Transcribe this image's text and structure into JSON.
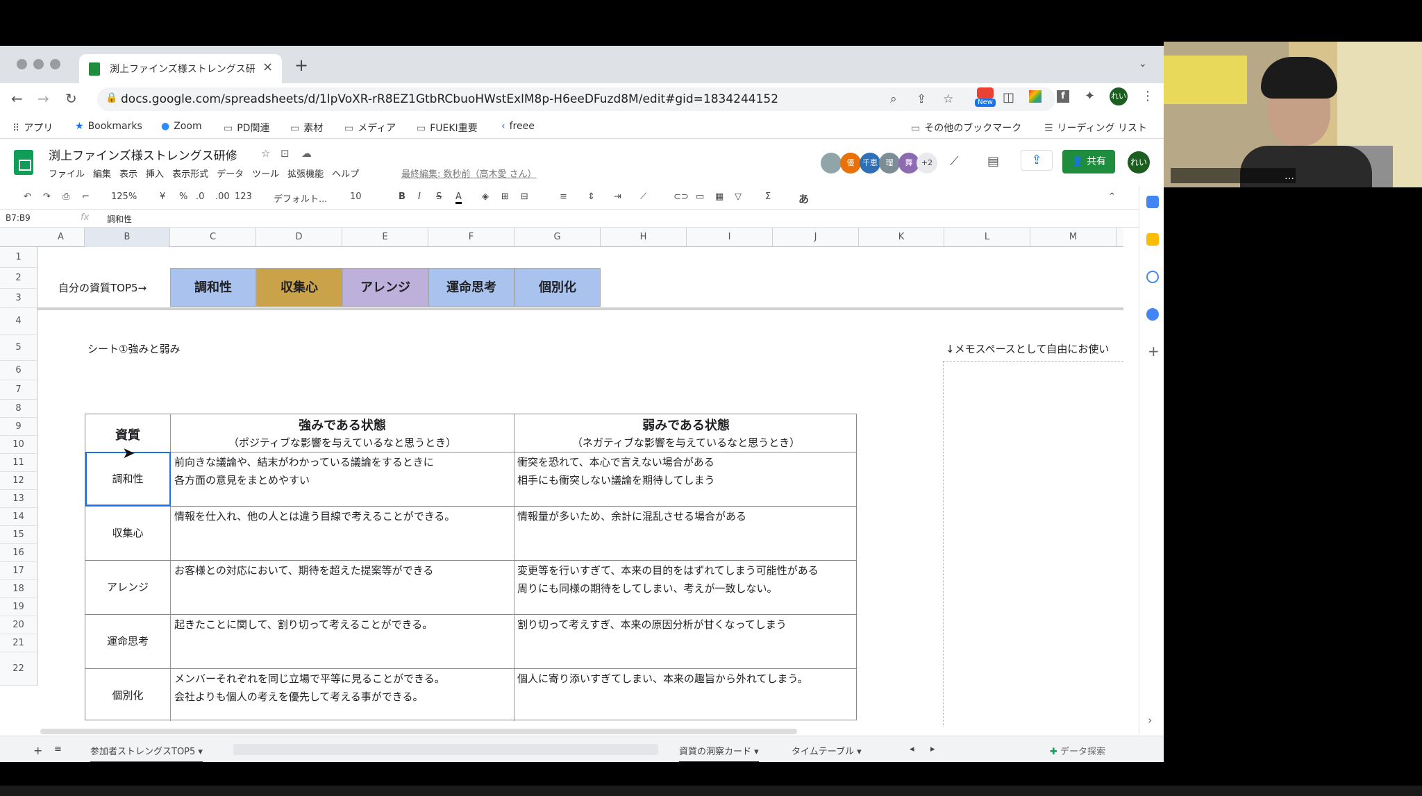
{
  "browser": {
    "tab_title": "渕上ファインズ様ストレングス研修",
    "url": "docs.google.com/spreadsheets/d/1lpVoXR-rR8EZ1GtbRCbuoHWstExlM8p-H6eeDFuzd8M/edit#gid=1834244152",
    "new_badge": "New",
    "profile": "れい"
  },
  "bookmarks": {
    "apps": "アプリ",
    "items": [
      "Bookmarks",
      "Zoom",
      "PD関連",
      "素材",
      "メディア",
      "FUEKI重要",
      "freee"
    ],
    "other": "その他のブックマーク",
    "reading_list": "リーディング リスト"
  },
  "app": {
    "doc_title": "渕上ファインズ様ストレングス研修",
    "menus": [
      "ファイル",
      "編集",
      "表示",
      "挿入",
      "表示形式",
      "データ",
      "ツール",
      "拡張機能",
      "ヘルプ"
    ],
    "last_edit": "最終編集: 数秒前（高木愛 さん）",
    "avatars": [
      "優",
      "千恵",
      "瑠",
      "舞"
    ],
    "avatar_more": "+2",
    "share": "共有",
    "me": "れい"
  },
  "format_toolbar": {
    "zoom": "125%",
    "currency": "¥",
    "percent": "%",
    "dec_less": ".0",
    "dec_more": ".00",
    "number_format": "123",
    "font": "デフォルト...",
    "font_size": "10",
    "input_method": "あ"
  },
  "formula_bar": {
    "name_box": "B7:B9",
    "fx": "fx",
    "content": "調和性"
  },
  "columns": [
    "A",
    "B",
    "C",
    "D",
    "E",
    "F",
    "G",
    "H",
    "I",
    "J",
    "K",
    "L",
    "M"
  ],
  "rows": [
    "1",
    "2",
    "3",
    "4",
    "5",
    "6",
    "7",
    "8",
    "9",
    "10",
    "11",
    "12",
    "13",
    "14",
    "15",
    "16",
    "17",
    "18",
    "19",
    "20",
    "21",
    "22"
  ],
  "sheet": {
    "top5_label": "自分の資質TOP5→",
    "top5": [
      "調和性",
      "収集心",
      "アレンジ",
      "運命思考",
      "個別化"
    ],
    "caption": "シート①強みと弱み",
    "memo_caption": "↓メモスペースとして自由にお使い",
    "table": {
      "col_talent": "資質",
      "col_strength": "強みである状態",
      "col_strength_sub": "（ポジティブな影響を与えているなと思うとき）",
      "col_weakness": "弱みである状態",
      "col_weakness_sub": "（ネガティブな影響を与えているなと思うとき）",
      "rows": [
        {
          "talent": "調和性",
          "strength1": "前向きな議論や、結末がわかっている議論をするときに",
          "strength2": "各方面の意見をまとめやすい",
          "weakness1": "衝突を恐れて、本心で言えない場合がある",
          "weakness2": "相手にも衝突しない議論を期待してしまう"
        },
        {
          "talent": "収集心",
          "strength1": "情報を仕入れ、他の人とは違う目線で考えることができる。",
          "strength2": "",
          "weakness1": "情報量が多いため、余計に混乱させる場合がある",
          "weakness2": ""
        },
        {
          "talent": "アレンジ",
          "strength1": "お客様との対応において、期待を超えた提案等ができる",
          "strength2": "",
          "weakness1": "変更等を行いすぎて、本来の目的をはずれてしまう可能性がある",
          "weakness2": "周りにも同様の期待をしてしまい、考えが一致しない。"
        },
        {
          "talent": "運命思考",
          "strength1": "起きたことに関して、割り切って考えることができる。",
          "strength2": "",
          "weakness1": "割り切って考えすぎ、本来の原因分析が甘くなってしまう",
          "weakness2": ""
        },
        {
          "talent": "個別化",
          "strength1": "メンバーそれぞれを同じ立場で平等に見ることができる。",
          "strength2": "会社よりも個人の考えを優先して考える事ができる。",
          "weakness1": "個人に寄り添いすぎてしまい、本来の趣旨から外れてしまう。",
          "weakness2": ""
        }
      ]
    }
  },
  "sheet_tabs": {
    "active": "参加者ストレングスTOP5",
    "tab2": "資質の洞察カード",
    "tab3": "タイムテーブル",
    "explore": "データ探索"
  },
  "colors": {
    "harmony": "#a9c3ee",
    "input": "#c9a24a",
    "arranger": "#bdb1dc",
    "connectedness": "#a9c3ee",
    "individualization": "#a9c3ee",
    "share": "#1e8e3e"
  }
}
